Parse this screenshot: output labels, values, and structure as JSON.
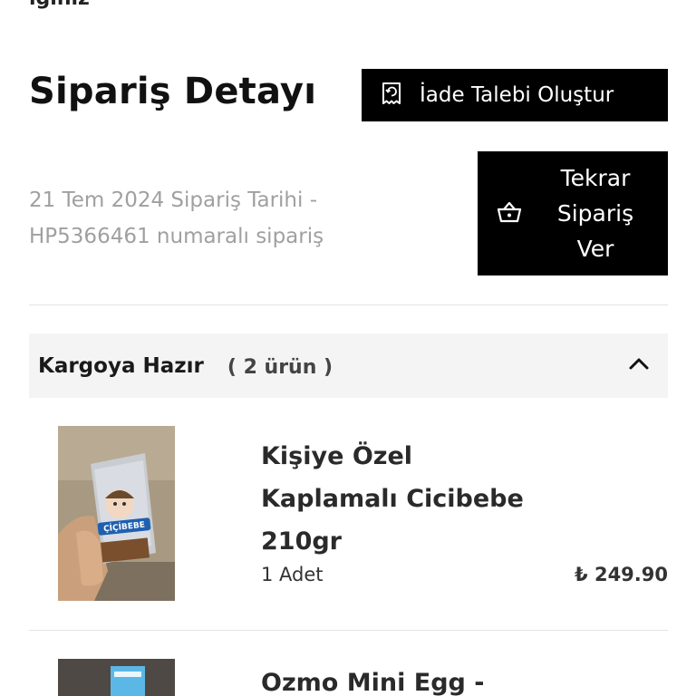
{
  "header_partial": "ığınız",
  "page": {
    "title": "Sipariş Detayı"
  },
  "actions": {
    "return_request_label": "İade Talebi Oluştur",
    "reorder_lines": [
      "Tekrar",
      "Sipariş",
      "Ver"
    ]
  },
  "order": {
    "date_line": "21 Tem 2024 Sipariş Tarihi -",
    "number_line": "HP5366461 numaralı sipariş"
  },
  "shipment": {
    "status": "Kargoya Hazır",
    "count": "( 2 ürün )"
  },
  "products": [
    {
      "name_lines": [
        "Kişiye Özel",
        "Kaplamalı Cicibebe",
        "210gr"
      ],
      "quantity": "1 Adet",
      "price": "₺ 249.90",
      "package_text": "ÇİÇİBEBE"
    },
    {
      "name": "Ozmo Mini Egg -"
    }
  ],
  "colors": {
    "button_bg": "#000000",
    "accordion_bg": "#f4f4f4",
    "muted_text": "#a0a0a0"
  }
}
